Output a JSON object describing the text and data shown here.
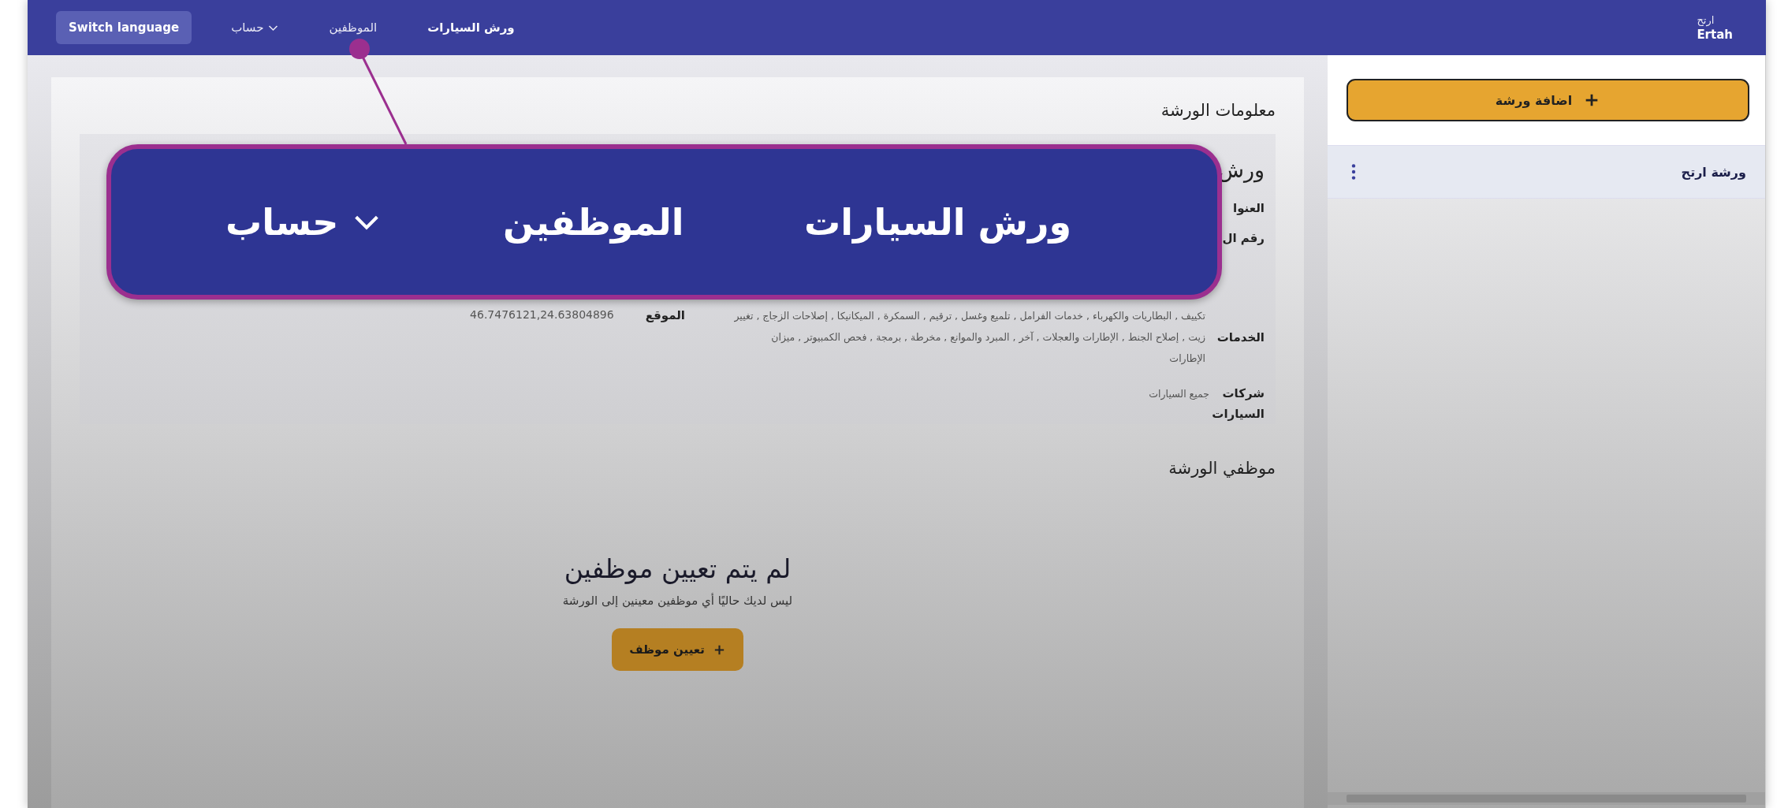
{
  "nav": {
    "brand": {
      "line_1": "ارتح",
      "line_2": "Ertah"
    },
    "links": [
      {
        "label": "ورش السيارات",
        "kind": "link",
        "selected": true
      },
      {
        "label": "الموظفين",
        "kind": "link",
        "selected": false
      },
      {
        "label": "حساب",
        "kind": "dropdown",
        "selected": false
      }
    ],
    "language_button": "Switch language"
  },
  "callout": {
    "items": [
      {
        "label": "ورش السيارات",
        "kind": "link"
      },
      {
        "label": "الموظفين",
        "kind": "link"
      },
      {
        "label": "حساب",
        "kind": "dropdown"
      }
    ]
  },
  "sidebar": {
    "add_button": "اضافة ورشة",
    "items": [
      {
        "label": "ورشة ارتح",
        "selected": true
      }
    ]
  },
  "workshop_info": {
    "title": "معلومات الورشة",
    "name": "ورش",
    "fields": [
      {
        "label": "العنوا"
      },
      {
        "label": "رقم ال"
      },
      {
        "label": "الخدمات",
        "value": "تكييف , البطاريات والكهرباء , خدمات الفرامل , تلميع وغسل , ترقيم , السمكرة , الميكانيكا , إصلاحات الزجاج , تغيير زيت , إصلاح الجنط , الإطارات والعجلات , آخر , المبرد والموانع , مخرطة , برمجة , فحص الكمبيوتر , ميزان الإطارات"
      },
      {
        "label": "شركات السيارات",
        "value": "جميع السيارات"
      }
    ],
    "location": {
      "label": "الموقع",
      "value": "46.7476121,24.63804896"
    }
  },
  "employees": {
    "title": "موظفي الورشة",
    "empty_title": "لم يتم تعيين موظفين",
    "empty_text": "ليس لديك حاليًا أي موظفين معينين إلى الورشة",
    "assign_button": "تعيين موظف"
  }
}
